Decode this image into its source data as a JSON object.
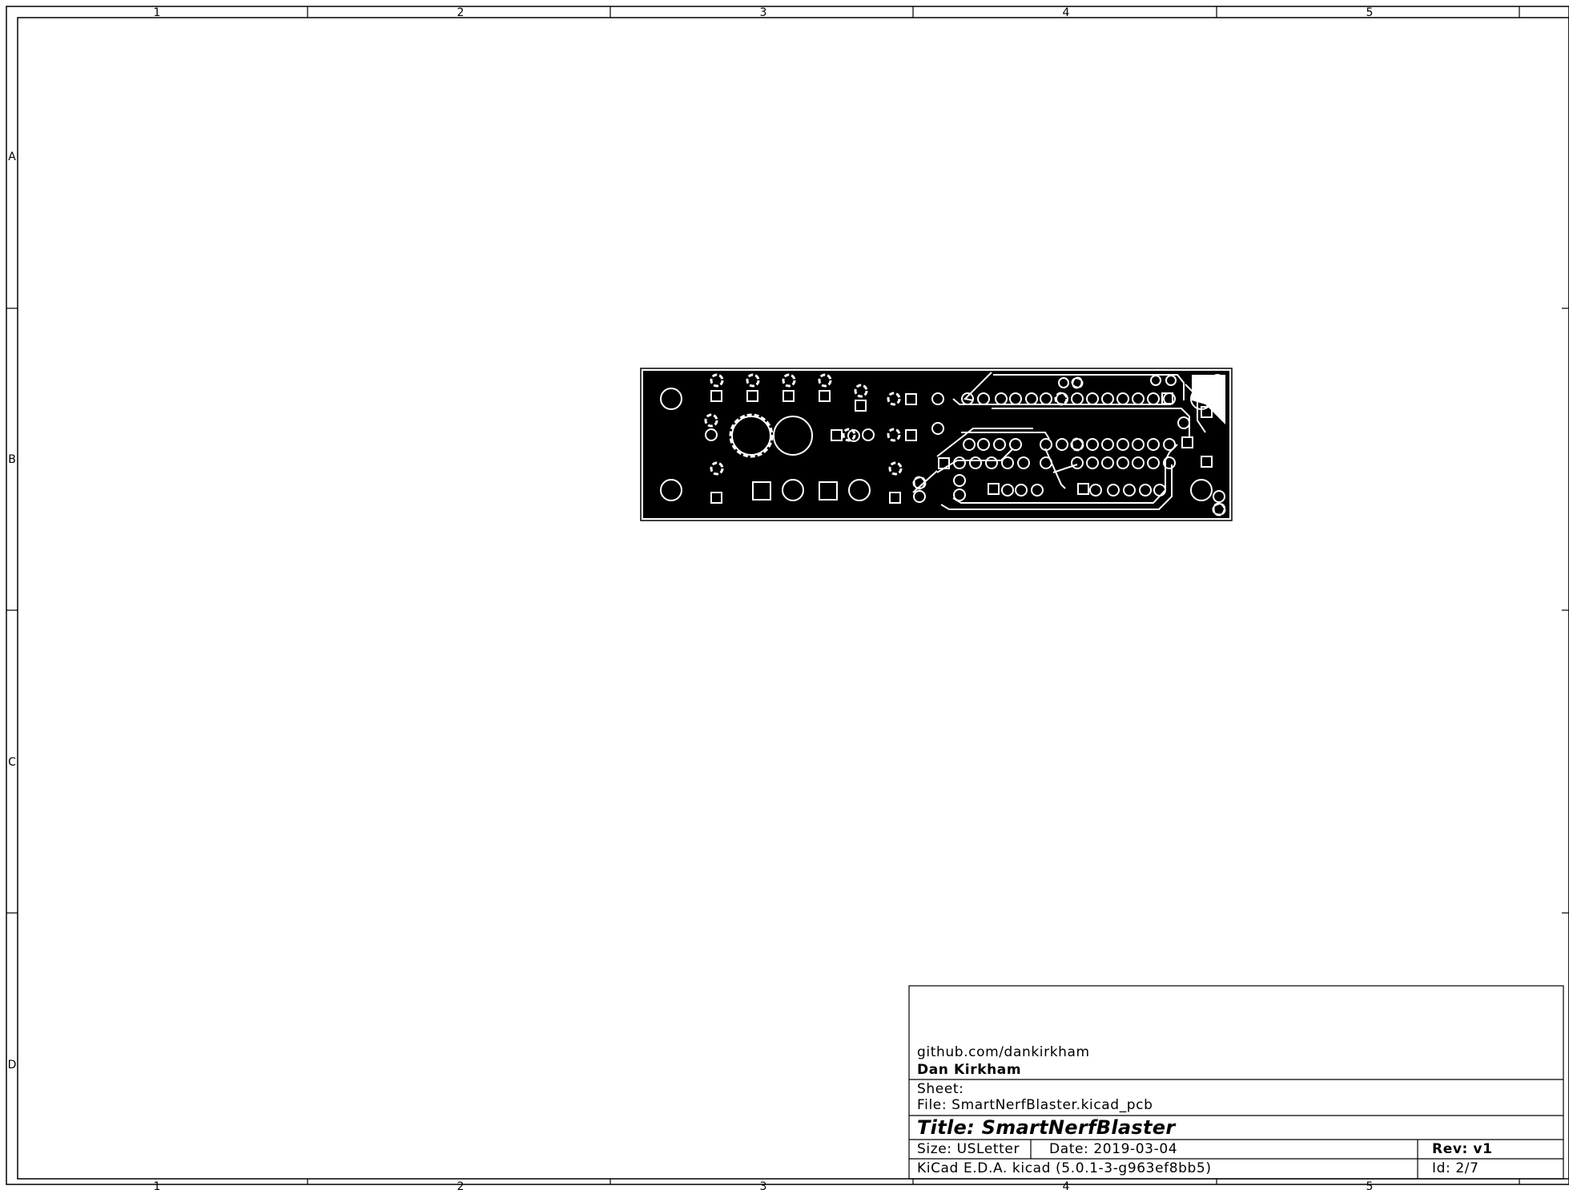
{
  "frame": {
    "columns": [
      "1",
      "2",
      "3",
      "4",
      "5"
    ],
    "rows": [
      "A",
      "B",
      "C",
      "D"
    ]
  },
  "title_block": {
    "company_url": "github.com/dankirkham",
    "author": "Dan Kirkham",
    "sheet": "Sheet:",
    "file": "File: SmartNerfBlaster.kicad_pcb",
    "title": "Title: SmartNerfBlaster",
    "size": "Size: USLetter",
    "date": "Date: 2019-03-04",
    "rev": "Rev: v1",
    "tool": "KiCad E.D.A.  kicad (5.0.1-3-g963ef8bb5)",
    "id": "Id: 2/7"
  },
  "board": {
    "layer_colors": {
      "copper": "#000000",
      "pad": "#ffffff",
      "outline": "#000000"
    }
  }
}
